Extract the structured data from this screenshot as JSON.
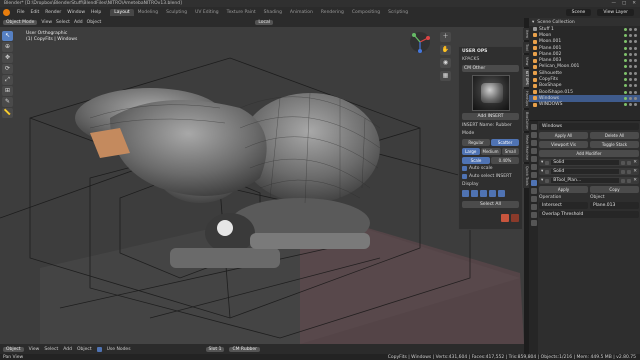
{
  "window": {
    "title": "Blender* [D:\\Dropbox\\BlenderStuff\\BlendFiles\\NITRO\\AmetebaNITROv13.blend]",
    "controls": [
      "—",
      "□",
      "✕"
    ]
  },
  "menu": {
    "items": [
      "File",
      "Edit",
      "Render",
      "Window",
      "Help"
    ],
    "tabs": [
      "Layout",
      "Modeling",
      "Sculpting",
      "UV Editing",
      "Texture Paint",
      "Shading",
      "Animation",
      "Rendering",
      "Compositing",
      "Scripting"
    ],
    "active_tab": "Layout",
    "scene_label": "Scene",
    "view_layer_label": "View Layer"
  },
  "viewport": {
    "header": {
      "mode": "Object Mode",
      "menus": [
        "View",
        "Select",
        "Add",
        "Object"
      ],
      "orientation": "Local"
    },
    "info": {
      "view": "User Orthographic",
      "collection": "(1) CopyFits | Windows"
    }
  },
  "toolbar": {
    "tools": [
      "cursor-select-icon",
      "cursor-icon",
      "move-icon",
      "rotate-icon",
      "scale-icon",
      "transform-icon",
      "annotate-icon",
      "measure-icon"
    ],
    "symbols": [
      "↖",
      "⊕",
      "✥",
      "⟳",
      "⤢",
      "⊞",
      "✎",
      "📏"
    ]
  },
  "npanel": {
    "section": "USER OPS",
    "header": "KPACKS",
    "material": "CM Other",
    "add_button": "Add INSERT",
    "insert_name": "INSERT Name: Rubber",
    "mode_label": "Mode",
    "modes": [
      "Regular",
      "Scatter"
    ],
    "sizes": [
      "Large",
      "Medium",
      "Small"
    ],
    "scale_label": "Scale",
    "scale_value": "0.40%",
    "auto_scale": "Auto scale",
    "auto_select": "Auto select INSERT",
    "display_label": "Display",
    "select_all": "Select All",
    "side_tabs": [
      "Item",
      "Tool",
      "View",
      "KIT OPS",
      "HardOps",
      "BoxCutter",
      "Mesh Machine",
      "Quick Tools"
    ]
  },
  "outliner": {
    "title": "Scene Collection",
    "rows": [
      {
        "name": "Stuff 1",
        "color": "#9a9a9a",
        "selected": false
      },
      {
        "name": "Moon",
        "color": "#e8a04a",
        "selected": false
      },
      {
        "name": "Moon.001",
        "color": "#e8a04a",
        "selected": false
      },
      {
        "name": "Plane.001",
        "color": "#e8a04a",
        "selected": false
      },
      {
        "name": "Plane.002",
        "color": "#e8a04a",
        "selected": false
      },
      {
        "name": "Plane.003",
        "color": "#e8a04a",
        "selected": false
      },
      {
        "name": "Pelican_Moon.001",
        "color": "#e8a04a",
        "selected": false
      },
      {
        "name": "Silhouette",
        "color": "#e8a04a",
        "selected": false
      },
      {
        "name": "CopyFits",
        "color": "#e8a04a",
        "selected": false
      },
      {
        "name": "BoxShape",
        "color": "#e8a04a",
        "selected": false
      },
      {
        "name": "BoolShape.015",
        "color": "#e8a04a",
        "selected": false
      },
      {
        "name": "Windows",
        "color": "#e8a04a",
        "selected": true
      },
      {
        "name": "WINDOWS",
        "color": "#e8a04a",
        "selected": false
      }
    ]
  },
  "properties": {
    "object_name": "Windows",
    "apply_all": "Apply All",
    "delete_all": "Delete All",
    "viewport_vis": "Viewport Vis",
    "toggle_stack": "Toggle Stack",
    "add_modifier": "Add Modifier",
    "modifiers": [
      {
        "name": "Solid"
      },
      {
        "name": "Solid"
      },
      {
        "name": "BTool_Plan..."
      }
    ],
    "apply": "Apply",
    "copy": "Copy",
    "operation_label": "Operation",
    "operation_value": "Intersect",
    "object_label": "Object",
    "object_value": "Plane.013",
    "overlap_label": "Overlap Threshold"
  },
  "bottombar": {
    "mode": "Object",
    "menus": [
      "View",
      "Select",
      "Add",
      "Object"
    ],
    "add_node": "Use Nodes",
    "slot": "Slot 1",
    "material": "CM Rubber"
  },
  "status": {
    "left": "Pan View",
    "right": "CopyFits | Windows | Verts:431,604 | Faces:417,552 | Tris:859,804 | Objects:1/216 | Mem: 449.5 MB | v2.80.75"
  }
}
